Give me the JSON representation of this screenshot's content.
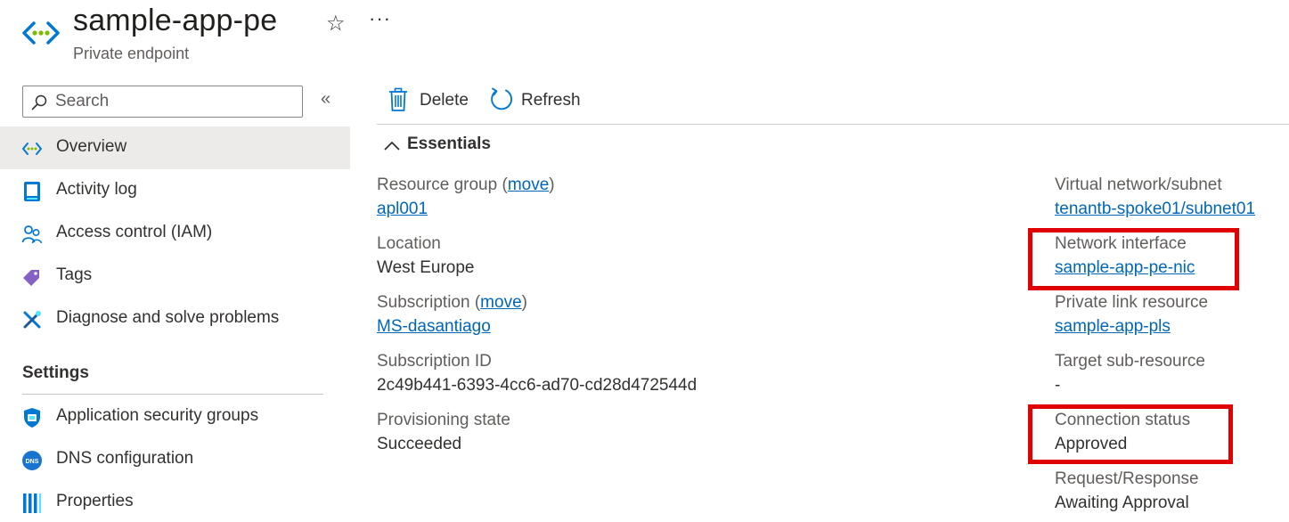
{
  "header": {
    "title": "sample-app-pe",
    "subtitle": "Private endpoint",
    "favorite_icon": "star-icon",
    "more_icon": "ellipsis-icon"
  },
  "sidebar": {
    "search_placeholder": "Search",
    "items": [
      {
        "label": "Overview",
        "icon": "private-endpoint-icon",
        "active": true
      },
      {
        "label": "Activity log",
        "icon": "activity-log-icon"
      },
      {
        "label": "Access control (IAM)",
        "icon": "people-icon"
      },
      {
        "label": "Tags",
        "icon": "tag-icon"
      },
      {
        "label": "Diagnose and solve problems",
        "icon": "wrench-icon"
      }
    ],
    "settings_header": "Settings",
    "settings_items": [
      {
        "label": "Application security groups",
        "icon": "shield-icon"
      },
      {
        "label": "DNS configuration",
        "icon": "dns-icon"
      },
      {
        "label": "Properties",
        "icon": "properties-icon"
      }
    ]
  },
  "toolbar": {
    "delete_label": "Delete",
    "refresh_label": "Refresh"
  },
  "essentials": {
    "label": "Essentials",
    "move_label": "move",
    "left": {
      "resource_group": {
        "label": "Resource group",
        "value": "apl001"
      },
      "location": {
        "label": "Location",
        "value": "West Europe"
      },
      "subscription": {
        "label": "Subscription",
        "value": "MS-dasantiago"
      },
      "subscription_id": {
        "label": "Subscription ID",
        "value": "2c49b441-6393-4cc6-ad70-cd28d472544d"
      },
      "provisioning_state": {
        "label": "Provisioning state",
        "value": "Succeeded"
      }
    },
    "right": {
      "vnet_subnet": {
        "label": "Virtual network/subnet",
        "value": "tenantb-spoke01/subnet01"
      },
      "network_interface": {
        "label": "Network interface",
        "value": "sample-app-pe-nic"
      },
      "private_link_resource": {
        "label": "Private link resource",
        "value": "sample-app-pls"
      },
      "target_sub_resource": {
        "label": "Target sub-resource",
        "value": "-"
      },
      "connection_status": {
        "label": "Connection status",
        "value": "Approved"
      },
      "request_response": {
        "label": "Request/Response",
        "value": "Awaiting Approval"
      }
    }
  },
  "colors": {
    "link": "#0067b8",
    "highlight": "#e00000",
    "active_nav": "#edebe9"
  }
}
